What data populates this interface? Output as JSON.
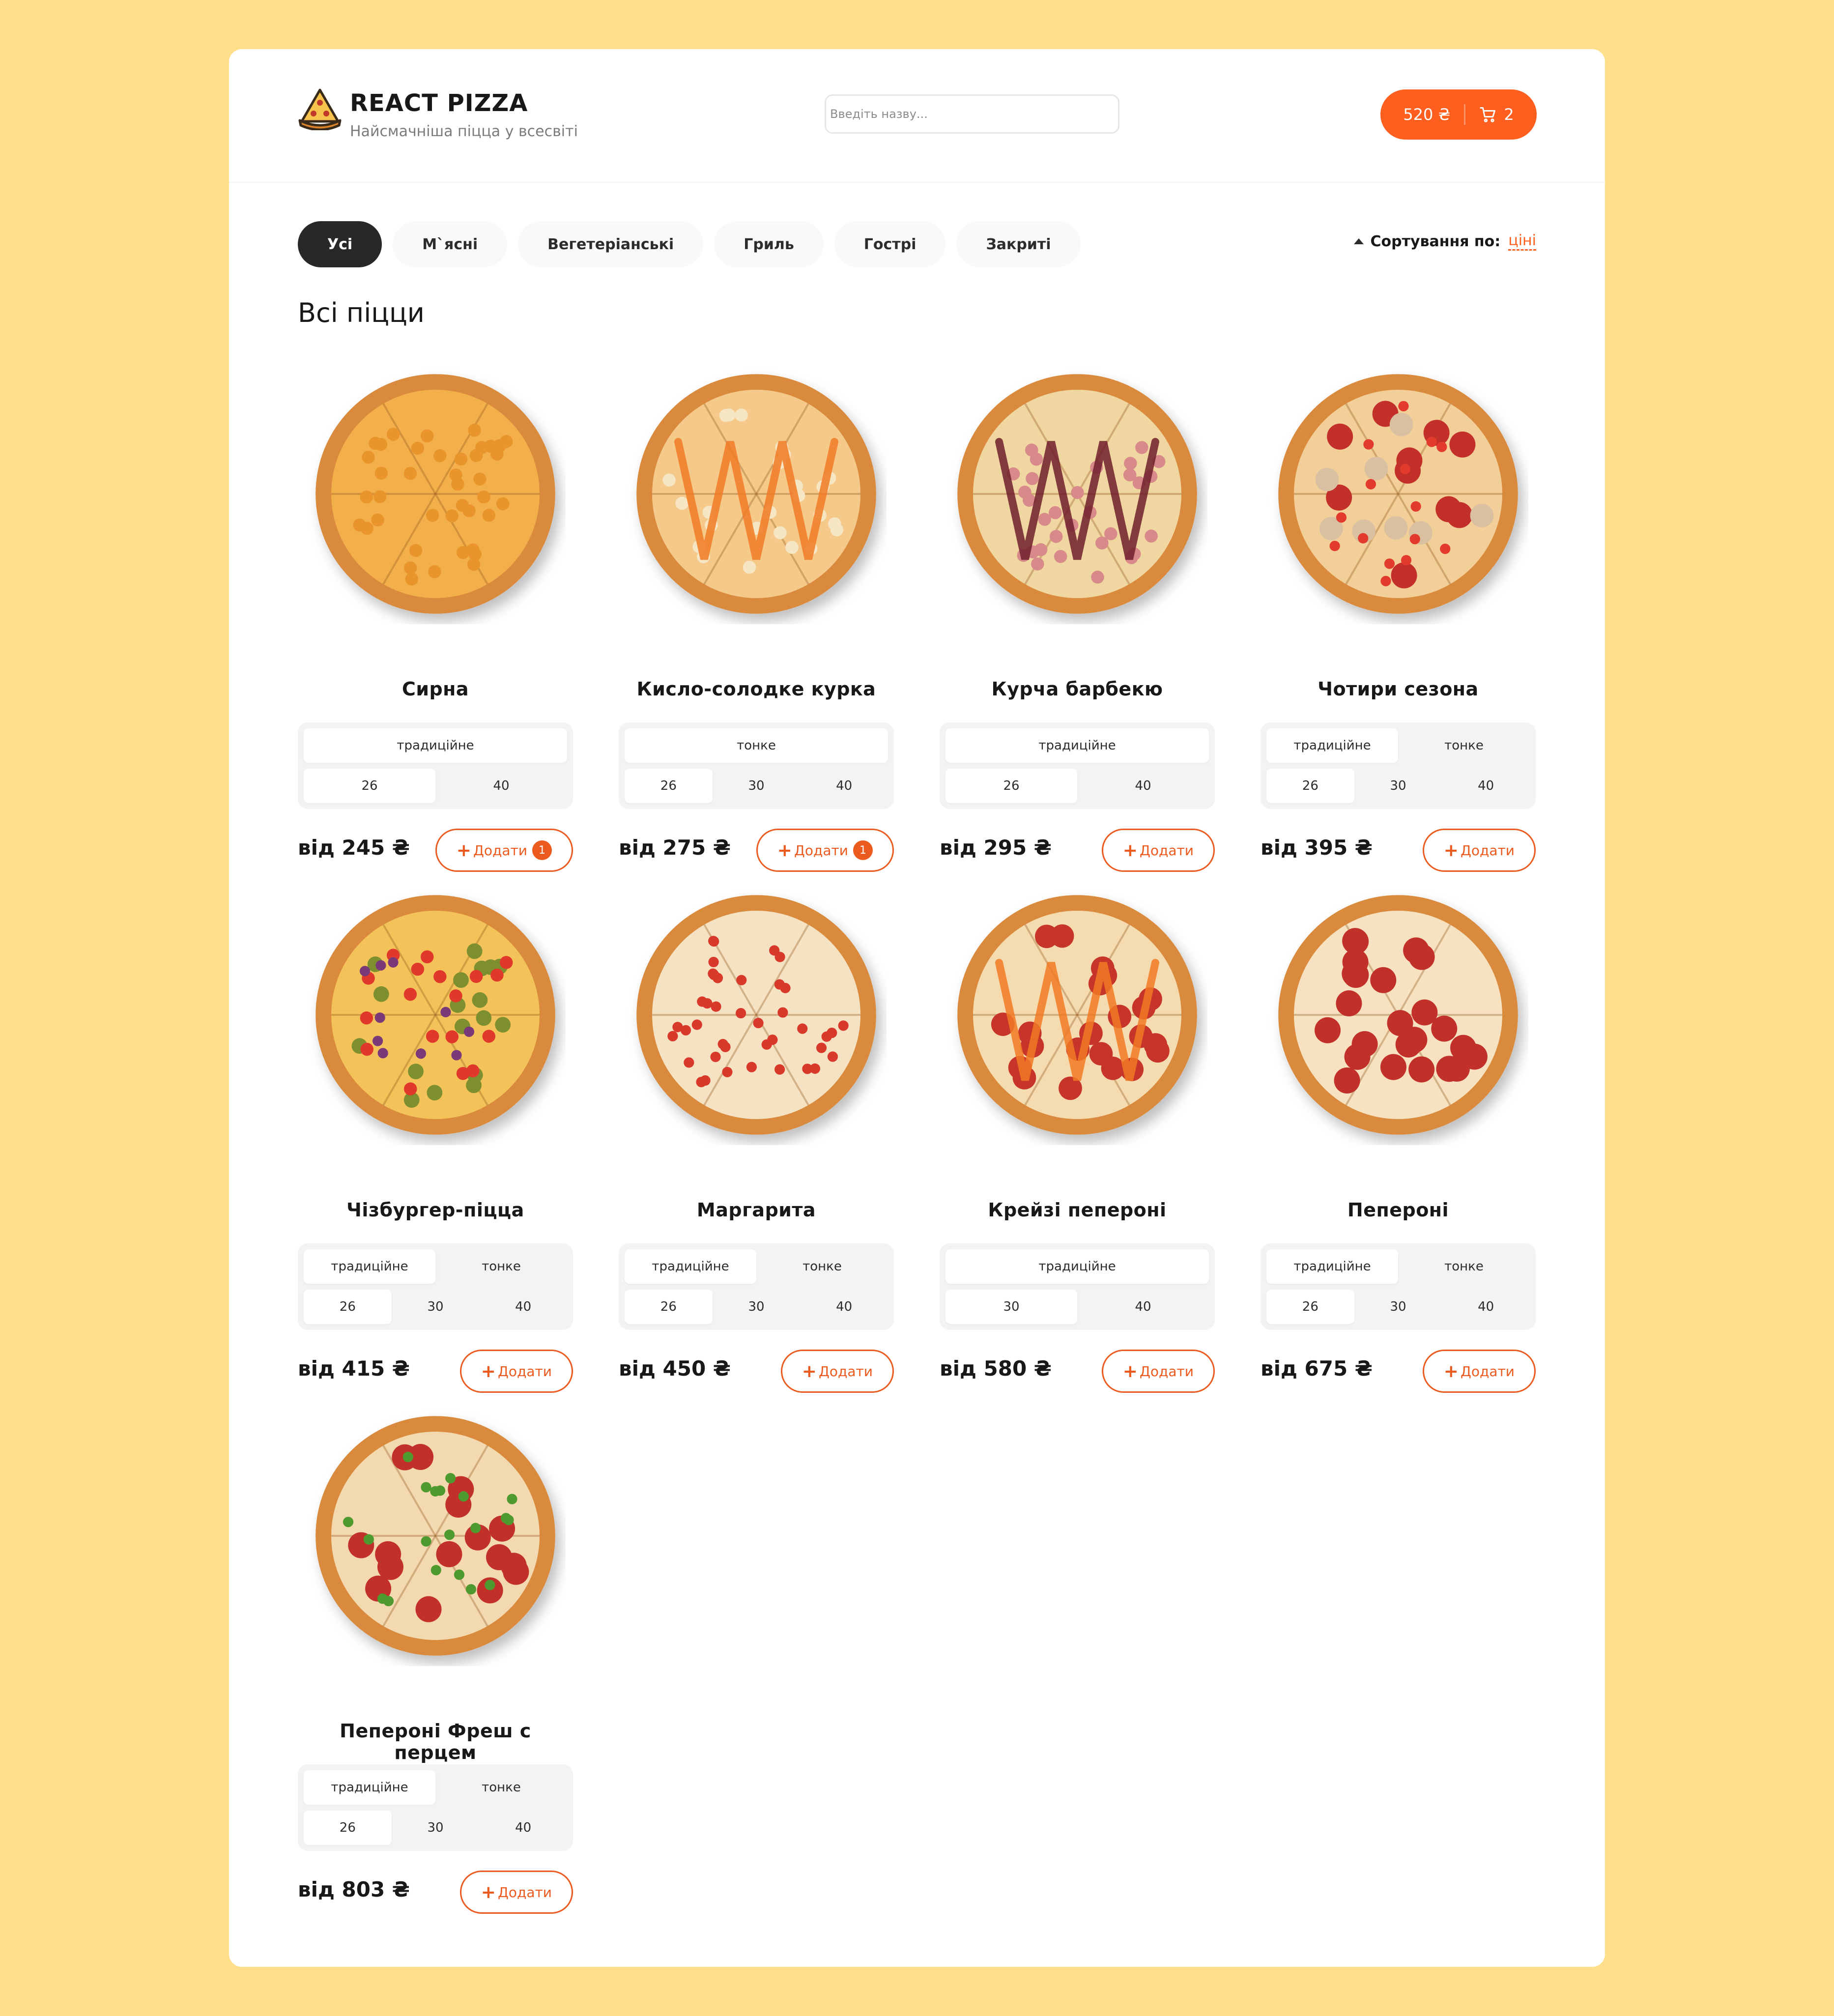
{
  "header": {
    "title": "REACT PIZZA",
    "subtitle": "Найсмачніша піцца у всесвіті",
    "search_placeholder": "Введіть назву...",
    "cart_total": "520 ₴",
    "cart_count": "2"
  },
  "categories": [
    "Усі",
    "М`ясні",
    "Вегетеріанські",
    "Гриль",
    "Гострі",
    "Закриті"
  ],
  "active_category": "Усі",
  "sort": {
    "label": "Сортування по:",
    "value": "ціні"
  },
  "section_title": "Всі піцци",
  "add_label": "Додати",
  "colors": {
    "accent": "#fe5f1e",
    "background": "#ffdf8c",
    "dark": "#282828"
  },
  "pizzas": [
    {
      "name": "Сирна",
      "price": "від 245 ₴",
      "types": [
        "традиційне"
      ],
      "active_type": 0,
      "sizes": [
        "26",
        "40"
      ],
      "active_size": 0,
      "count": "1",
      "style": "cheese"
    },
    {
      "name": "Кисло-солодке курка",
      "price": "від 275 ₴",
      "types": [
        "тонке"
      ],
      "active_type": 0,
      "sizes": [
        "26",
        "30",
        "40"
      ],
      "active_size": 0,
      "count": "1",
      "style": "sweet"
    },
    {
      "name": "Курча барбекю",
      "price": "від 295 ₴",
      "types": [
        "традиційне"
      ],
      "active_type": 0,
      "sizes": [
        "26",
        "40"
      ],
      "active_size": 0,
      "count": "",
      "style": "bbq"
    },
    {
      "name": "Чотири сезона",
      "price": "від 395 ₴",
      "types": [
        "традиційне",
        "тонке"
      ],
      "active_type": 0,
      "sizes": [
        "26",
        "30",
        "40"
      ],
      "active_size": 0,
      "count": "",
      "style": "seasons"
    },
    {
      "name": "Чізбургер-піцца",
      "price": "від 415 ₴",
      "types": [
        "традиційне",
        "тонке"
      ],
      "active_type": 0,
      "sizes": [
        "26",
        "30",
        "40"
      ],
      "active_size": 0,
      "count": "",
      "style": "burger"
    },
    {
      "name": "Маргарита",
      "price": "від 450 ₴",
      "types": [
        "традиційне",
        "тонке"
      ],
      "active_type": 0,
      "sizes": [
        "26",
        "30",
        "40"
      ],
      "active_size": 0,
      "count": "",
      "style": "margarita"
    },
    {
      "name": "Крейзі пепероні",
      "price": "від 580 ₴",
      "types": [
        "традиційне"
      ],
      "active_type": 0,
      "sizes": [
        "30",
        "40"
      ],
      "active_size": 0,
      "count": "",
      "style": "crazy"
    },
    {
      "name": "Пепероні",
      "price": "від 675 ₴",
      "types": [
        "традиційне",
        "тонке"
      ],
      "active_type": 0,
      "sizes": [
        "26",
        "30",
        "40"
      ],
      "active_size": 0,
      "count": "",
      "style": "pepperoni"
    },
    {
      "name": "Пепероні Фреш с перцем",
      "price": "від 803 ₴",
      "types": [
        "традиційне",
        "тонке"
      ],
      "active_type": 0,
      "sizes": [
        "26",
        "30",
        "40"
      ],
      "active_size": 0,
      "count": "",
      "style": "fresh"
    }
  ]
}
